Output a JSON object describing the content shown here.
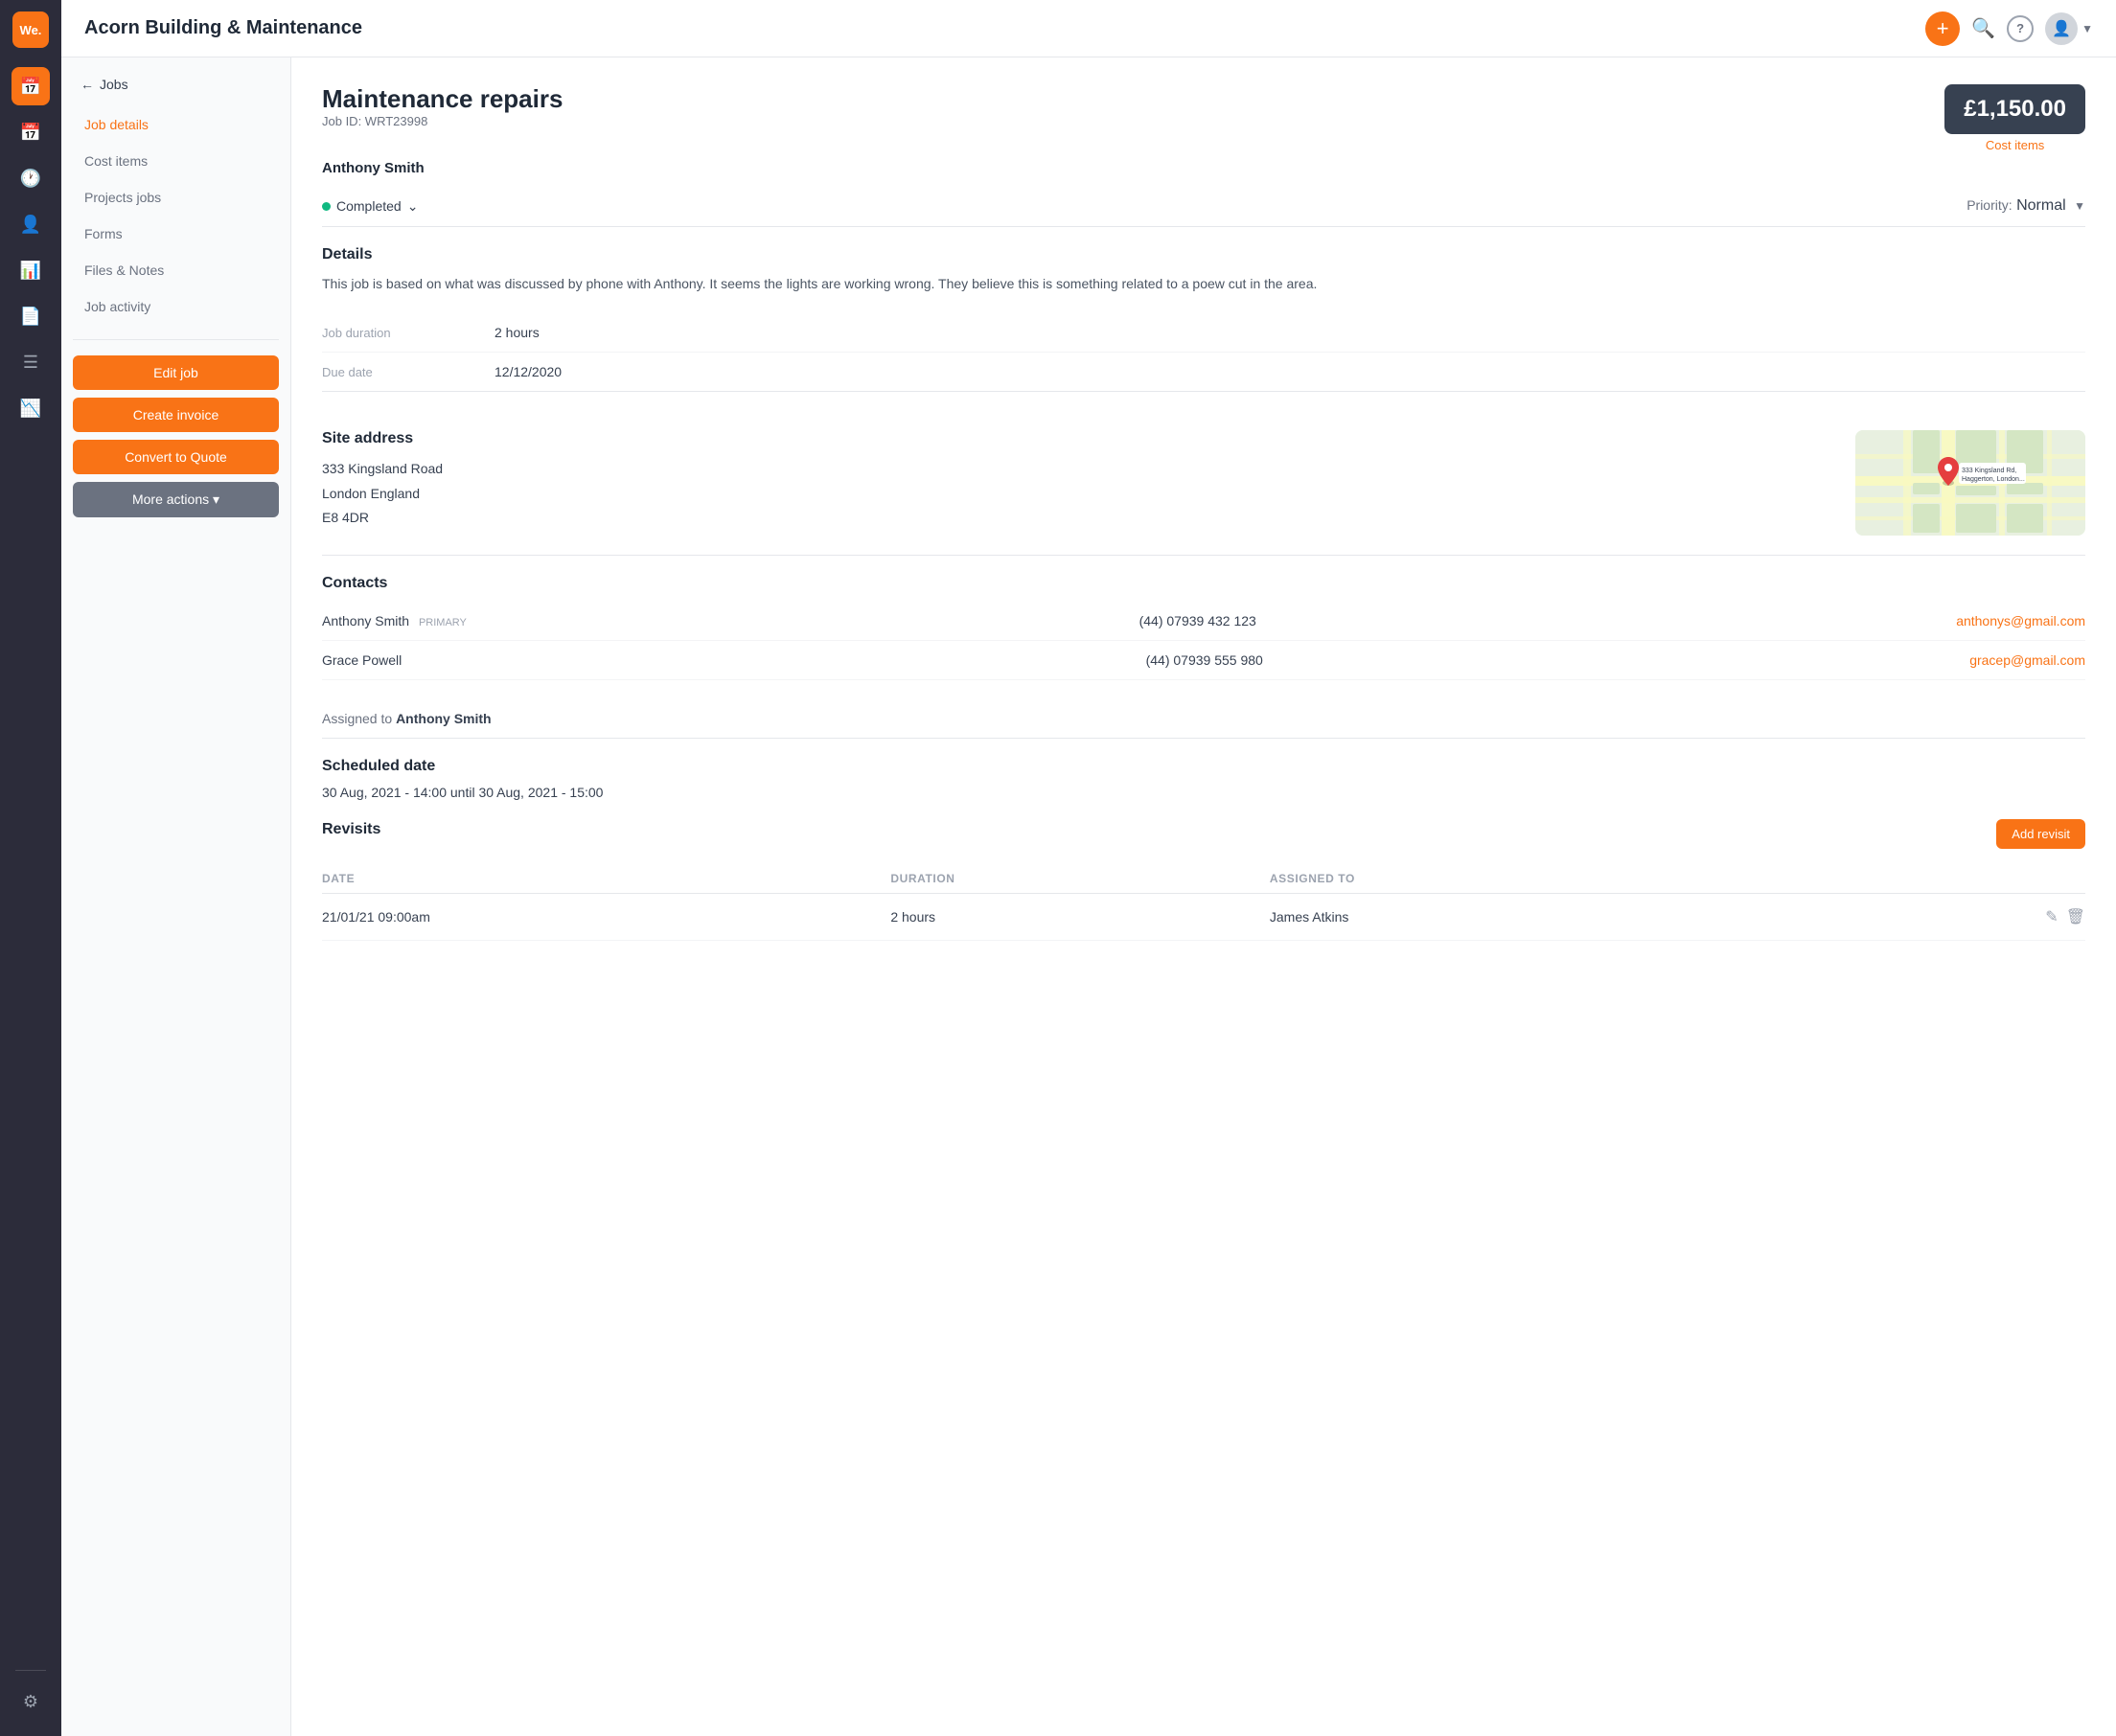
{
  "app": {
    "logo": "We.",
    "company_name": "Acorn Building & Maintenance"
  },
  "nav": {
    "icons": [
      "briefcase",
      "calendar",
      "clock",
      "users",
      "file-text",
      "bar-chart",
      "settings"
    ],
    "active_index": 0
  },
  "sidebar": {
    "back_label": "Jobs",
    "items": [
      {
        "id": "job-details",
        "label": "Job details",
        "active": true
      },
      {
        "id": "cost-items",
        "label": "Cost items",
        "active": false
      },
      {
        "id": "projects-jobs",
        "label": "Projects jobs",
        "active": false
      },
      {
        "id": "forms",
        "label": "Forms",
        "active": false
      },
      {
        "id": "files-notes",
        "label": "Files & Notes",
        "active": false
      },
      {
        "id": "job-activity",
        "label": "Job activity",
        "active": false
      }
    ],
    "buttons": [
      {
        "id": "edit-job",
        "label": "Edit job",
        "style": "orange"
      },
      {
        "id": "create-invoice",
        "label": "Create invoice",
        "style": "orange"
      },
      {
        "id": "convert-to-quote",
        "label": "Convert to Quote",
        "style": "orange"
      },
      {
        "id": "more-actions",
        "label": "More actions ▾",
        "style": "gray"
      }
    ]
  },
  "job": {
    "title": "Maintenance repairs",
    "id": "Job ID: WRT23998",
    "customer": "Anthony Smith",
    "cost": "£1,150.00",
    "cost_link": "Cost items",
    "status": "Completed",
    "priority_label": "Priority:",
    "priority_value": "Normal",
    "details_heading": "Details",
    "details_text": "This job is based on what was discussed by phone with Anthony. It seems the lights are working wrong. They believe this is something related to a poew cut in the area.",
    "job_duration_label": "Job duration",
    "job_duration_value": "2 hours",
    "due_date_label": "Due date",
    "due_date_value": "12/12/2020",
    "site_address": {
      "heading": "Site address",
      "line1": "333 Kingsland Road",
      "line2": "London England",
      "line3": "E8 4DR"
    },
    "contacts": {
      "heading": "Contacts",
      "list": [
        {
          "name": "Anthony Smith",
          "badge": "PRIMARY",
          "phone": "(44) 07939 432 123",
          "email": "anthonys@gmail.com"
        },
        {
          "name": "Grace Powell",
          "badge": "",
          "phone": "(44) 07939 555 980",
          "email": "gracep@gmail.com"
        }
      ]
    },
    "assigned_to_label": "Assigned to",
    "assigned_to_name": "Anthony Smith",
    "scheduled": {
      "heading": "Scheduled date",
      "value": "30 Aug, 2021 - 14:00 until 30 Aug, 2021 - 15:00"
    },
    "revisits": {
      "heading": "Revisits",
      "add_label": "Add revisit",
      "columns": [
        "DATE",
        "DURATION",
        "ASSIGNED TO"
      ],
      "rows": [
        {
          "date": "21/01/21 09:00am",
          "duration": "2 hours",
          "assigned_to": "James Atkins"
        }
      ]
    }
  },
  "header_icons": {
    "add": "+",
    "search": "🔍",
    "help": "?",
    "chevron": "▾"
  }
}
